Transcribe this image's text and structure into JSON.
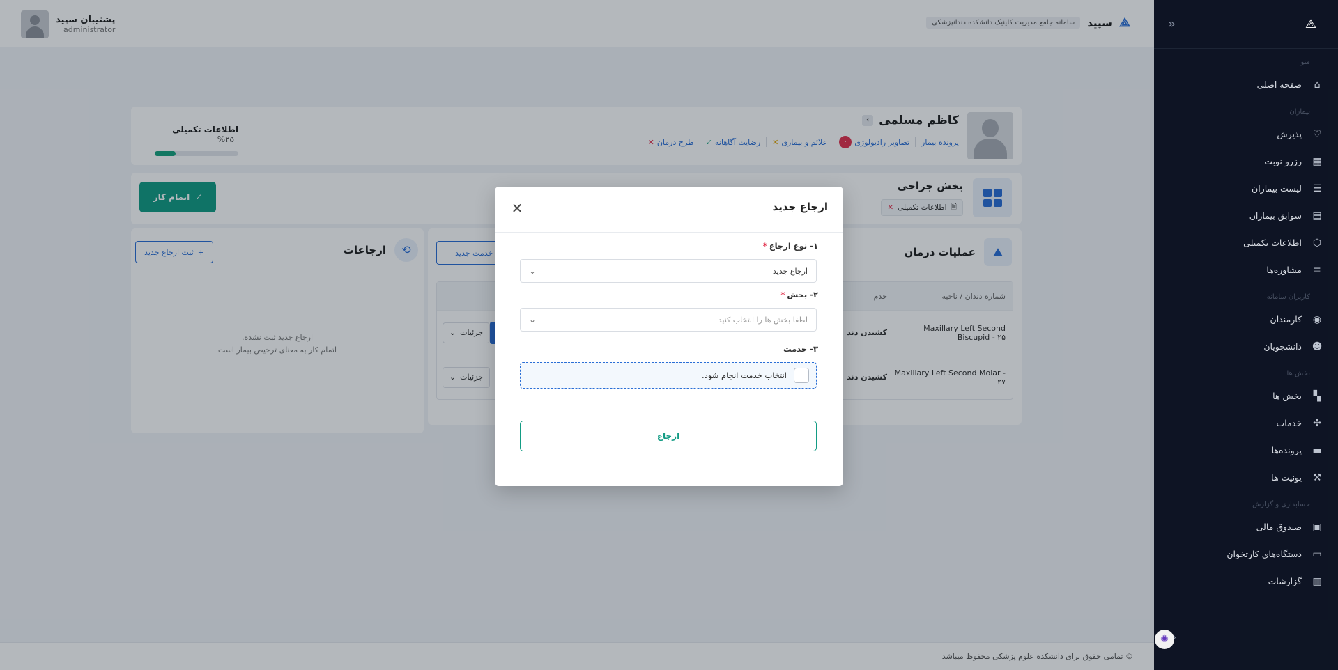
{
  "header": {
    "brand_name": "سپید",
    "brand_tagline": "سامانه جامع مدیریت کلینیک دانشکده دندانپزشکی",
    "user_name": "پشتیبان سپید",
    "user_role": "administrator"
  },
  "sidebar": {
    "groups": [
      {
        "label": "منو",
        "items": [
          {
            "label": "صفحه اصلی",
            "icon": "home-icon"
          }
        ]
      },
      {
        "label": "بیماران",
        "items": [
          {
            "label": "پذیرش",
            "icon": "pulse-icon"
          },
          {
            "label": "رزرو نوبت",
            "icon": "calendar-icon"
          },
          {
            "label": "لیست بیماران",
            "icon": "patient-list-icon"
          },
          {
            "label": "سوابق بیماران",
            "icon": "document-icon"
          },
          {
            "label": "اطلاعات تکمیلی",
            "icon": "cube-icon"
          },
          {
            "label": "مشاوره‌ها",
            "icon": "sliders-icon"
          }
        ]
      },
      {
        "label": "کاربران سامانه",
        "items": [
          {
            "label": "کارمندان",
            "icon": "user-circle-icon"
          },
          {
            "label": "دانشجویان",
            "icon": "students-icon"
          }
        ]
      },
      {
        "label": "بخش ها",
        "items": [
          {
            "label": "بخش ها",
            "icon": "grid-icon"
          },
          {
            "label": "خدمات",
            "icon": "pinwheel-icon"
          },
          {
            "label": "پرونده‌ها",
            "icon": "folder-icon"
          },
          {
            "label": "یونیت ها",
            "icon": "tool-icon"
          }
        ]
      },
      {
        "label": "حسابداری و گزارش",
        "items": [
          {
            "label": "صندوق مالی",
            "icon": "cash-box-icon"
          },
          {
            "label": "دستگاه‌های کارتخوان",
            "icon": "card-reader-icon"
          },
          {
            "label": "گزارشات",
            "icon": "report-icon"
          }
        ]
      }
    ]
  },
  "patient": {
    "name": "کاظم مسلمی",
    "links": {
      "file": "پرونده بیمار",
      "radiology": "تصاویر رادیولوژی",
      "radiology_count": "۰",
      "symptoms": "علائم و بیماری",
      "consent": "رضایت آگاهانه",
      "treatment_plan": "طرح درمان"
    },
    "progress_title": "اطلاعات تکمیلی",
    "progress_value": "۲۵%",
    "progress_fraction": 0.25
  },
  "section": {
    "title": "بخش جراحی",
    "badge": "اطلاعات تکمیلی",
    "finish_button": "اتمام کار"
  },
  "referrals": {
    "title": "ارجاعات",
    "add_button": "ثبت ارجاع جدید",
    "empty_line1": "ارجاع جدید ثبت نشده.",
    "empty_line2": "اتمام کار به معنای ترخیص بیمار است"
  },
  "operations": {
    "title": "عملیات درمان",
    "new_service_button": "ن خدمت جدید",
    "columns": [
      "شماره دندان / ناحیه",
      "خدم"
    ],
    "rows": [
      {
        "tooth": "Maxillary Left Second Biscupid - ۲۵",
        "service": "کشیدن دند",
        "details": "جزئیات"
      },
      {
        "tooth": "Maxillary Left Second Molar - ۲۷",
        "service": "کشیدن دند",
        "details": "جزئیات"
      }
    ]
  },
  "footer": {
    "text": "© تمامی حقوق برای دانشکده علوم پزشکی محفوظ میباشد"
  },
  "modal": {
    "title": "ارجاع جدید",
    "field1_label": "۱- نوع ارجاع",
    "field1_value": "ارجاع جدید",
    "field2_label": "۲- بخش",
    "field2_placeholder": "لطفا بخش ها را انتخاب کنید",
    "field3_label": "۳- خدمت",
    "checkbox_label": "انتخاب خدمت انجام شود.",
    "submit_button": "ارجاع"
  }
}
